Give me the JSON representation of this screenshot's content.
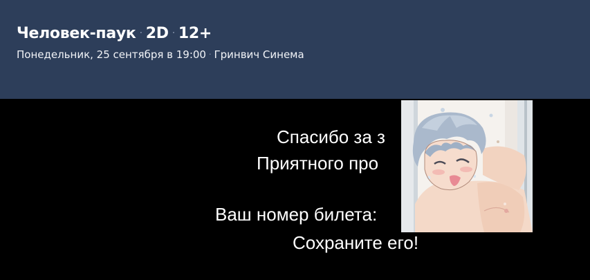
{
  "header": {
    "movie_title": "Человек-паук",
    "format": "2D",
    "age_rating": "12+",
    "separator": "·",
    "date_time": "Понедельник, 25 сентября в 19:00",
    "cinema": "Гринвич Синема"
  },
  "message": {
    "line1": "Спасибо за з",
    "line2": "Приятного про",
    "line3": "Ваш номер билета:",
    "line4": "Сохраните его!"
  },
  "colors": {
    "header_bg": "#2d3e5a",
    "content_bg": "#000000",
    "text": "#ffffff"
  },
  "overlay_image": {
    "icon": "anime-illustration-image"
  }
}
